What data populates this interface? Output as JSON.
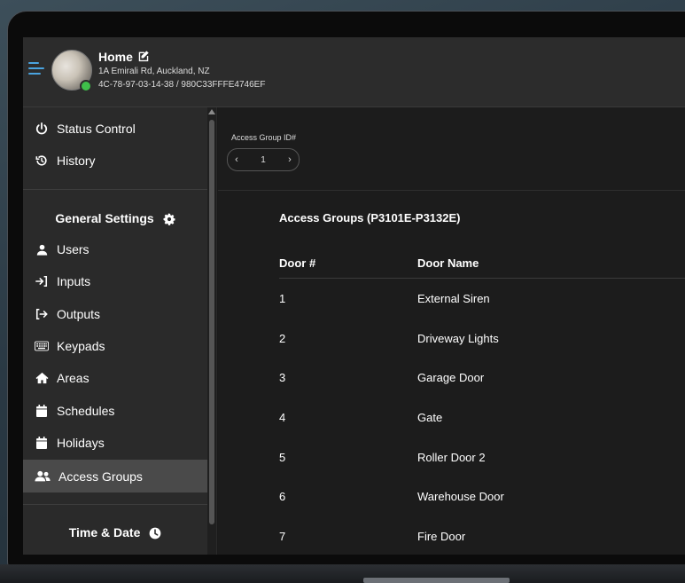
{
  "header": {
    "title": "Home",
    "address": "1A Emirali Rd, Auckland, NZ",
    "device_id": "4C-78-97-03-14-38 / 980C33FFFE4746EF"
  },
  "sidebar": {
    "top_items": [
      {
        "label": "Status Control",
        "icon": "power-icon"
      },
      {
        "label": "History",
        "icon": "history-icon"
      }
    ],
    "general_settings_title": "General Settings",
    "items": [
      {
        "label": "Users",
        "icon": "user-icon"
      },
      {
        "label": "Inputs",
        "icon": "input-icon"
      },
      {
        "label": "Outputs",
        "icon": "output-icon"
      },
      {
        "label": "Keypads",
        "icon": "keyboard-icon"
      },
      {
        "label": "Areas",
        "icon": "home-icon"
      },
      {
        "label": "Schedules",
        "icon": "calendar-icon"
      },
      {
        "label": "Holidays",
        "icon": "calendar-icon"
      },
      {
        "label": "Access Groups",
        "icon": "users-icon",
        "active": true
      }
    ],
    "time_date_title": "Time & Date"
  },
  "main": {
    "access_group_label": "Access Group ID#",
    "access_group_value": "1",
    "table_title": "Access Groups (P3101E-P3132E)",
    "columns": [
      "Door #",
      "Door Name"
    ],
    "rows": [
      {
        "num": "1",
        "name": "External Siren"
      },
      {
        "num": "2",
        "name": "Driveway Lights"
      },
      {
        "num": "3",
        "name": "Garage Door"
      },
      {
        "num": "4",
        "name": "Gate"
      },
      {
        "num": "5",
        "name": "Roller Door 2"
      },
      {
        "num": "6",
        "name": "Warehouse Door"
      },
      {
        "num": "7",
        "name": "Fire Door"
      }
    ]
  },
  "colors": {
    "accent": "#4aa3df",
    "status_online": "#3fbf4a"
  }
}
